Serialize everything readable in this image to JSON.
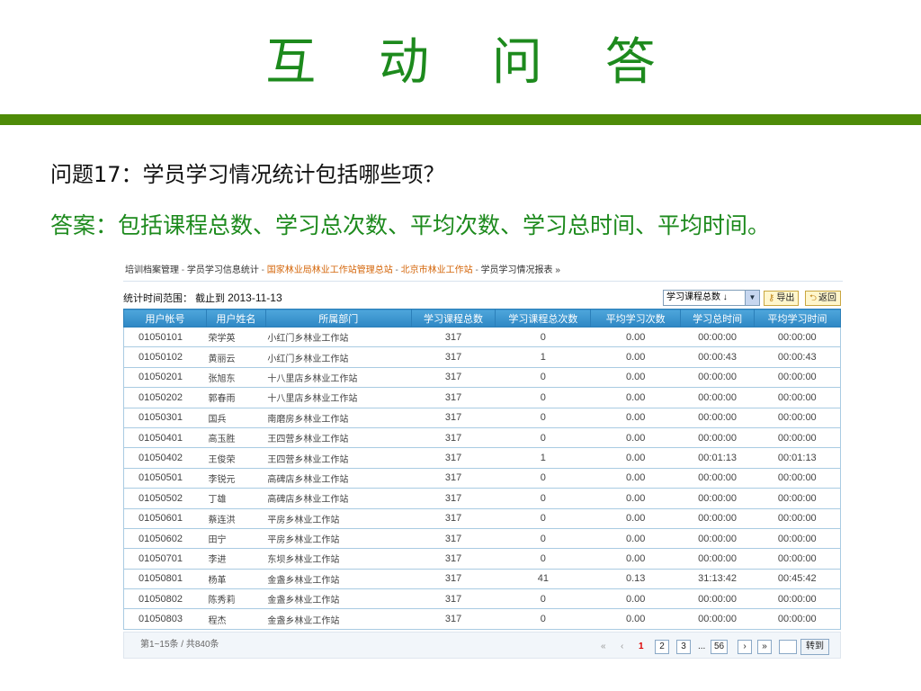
{
  "title": "互 动 问 答",
  "question": "问题17：学员学习情况统计包括哪些项？",
  "answer": "答案：包括课程总数、学习总次数、平均次数、学习总时间、平均时间。",
  "colors": {
    "accent_green": "#1d8a1d",
    "bar_green": "#4e8b08",
    "header_blue": "#3a96d0"
  },
  "breadcrumb": {
    "item1": "培训档案管理",
    "item2": "学员学习信息统计",
    "item3": "国家林业局林业工作站管理总站",
    "item4": "北京市林业工作站",
    "item5": "学员学习情况报表 »",
    "separator": " - "
  },
  "filter": {
    "range_label": "统计时间范围：",
    "range_prefix": "截止到",
    "range_date": "2013-11-13",
    "sort_selected": "学习课程总数 ↓",
    "export_label": "导出",
    "back_label": "返回",
    "export_icon": "key-icon",
    "back_icon": "return-icon"
  },
  "table": {
    "columns": [
      "用户帐号",
      "用户姓名",
      "所属部门",
      "学习课程总数",
      "学习课程总次数",
      "平均学习次数",
      "学习总时间",
      "平均学习时间"
    ],
    "rows": [
      [
        "01050101",
        "荣学英",
        "小红门乡林业工作站",
        "317",
        "0",
        "0.00",
        "00:00:00",
        "00:00:00"
      ],
      [
        "01050102",
        "黄丽云",
        "小红门乡林业工作站",
        "317",
        "1",
        "0.00",
        "00:00:43",
        "00:00:43"
      ],
      [
        "01050201",
        "张旭东",
        "十八里店乡林业工作站",
        "317",
        "0",
        "0.00",
        "00:00:00",
        "00:00:00"
      ],
      [
        "01050202",
        "郭春雨",
        "十八里店乡林业工作站",
        "317",
        "0",
        "0.00",
        "00:00:00",
        "00:00:00"
      ],
      [
        "01050301",
        "国兵",
        "南磨房乡林业工作站",
        "317",
        "0",
        "0.00",
        "00:00:00",
        "00:00:00"
      ],
      [
        "01050401",
        "高玉胜",
        "王四营乡林业工作站",
        "317",
        "0",
        "0.00",
        "00:00:00",
        "00:00:00"
      ],
      [
        "01050402",
        "王俊荣",
        "王四营乡林业工作站",
        "317",
        "1",
        "0.00",
        "00:01:13",
        "00:01:13"
      ],
      [
        "01050501",
        "李锐元",
        "高碑店乡林业工作站",
        "317",
        "0",
        "0.00",
        "00:00:00",
        "00:00:00"
      ],
      [
        "01050502",
        "丁雄",
        "高碑店乡林业工作站",
        "317",
        "0",
        "0.00",
        "00:00:00",
        "00:00:00"
      ],
      [
        "01050601",
        "蔡连洪",
        "平房乡林业工作站",
        "317",
        "0",
        "0.00",
        "00:00:00",
        "00:00:00"
      ],
      [
        "01050602",
        "田宁",
        "平房乡林业工作站",
        "317",
        "0",
        "0.00",
        "00:00:00",
        "00:00:00"
      ],
      [
        "01050701",
        "李进",
        "东坝乡林业工作站",
        "317",
        "0",
        "0.00",
        "00:00:00",
        "00:00:00"
      ],
      [
        "01050801",
        "杨革",
        "金盏乡林业工作站",
        "317",
        "41",
        "0.13",
        "31:13:42",
        "00:45:42"
      ],
      [
        "01050802",
        "陈秀莉",
        "金盏乡林业工作站",
        "317",
        "0",
        "0.00",
        "00:00:00",
        "00:00:00"
      ],
      [
        "01050803",
        "程杰",
        "金盏乡林业工作站",
        "317",
        "0",
        "0.00",
        "00:00:00",
        "00:00:00"
      ]
    ]
  },
  "pager": {
    "summary": "第1~15条 / 共840条",
    "first": "«",
    "prev": "‹",
    "current": "1",
    "page2": "2",
    "page3": "3",
    "ellipsis": "...",
    "last_page": "56",
    "next": "›",
    "last": "»",
    "go_label": "转到"
  }
}
